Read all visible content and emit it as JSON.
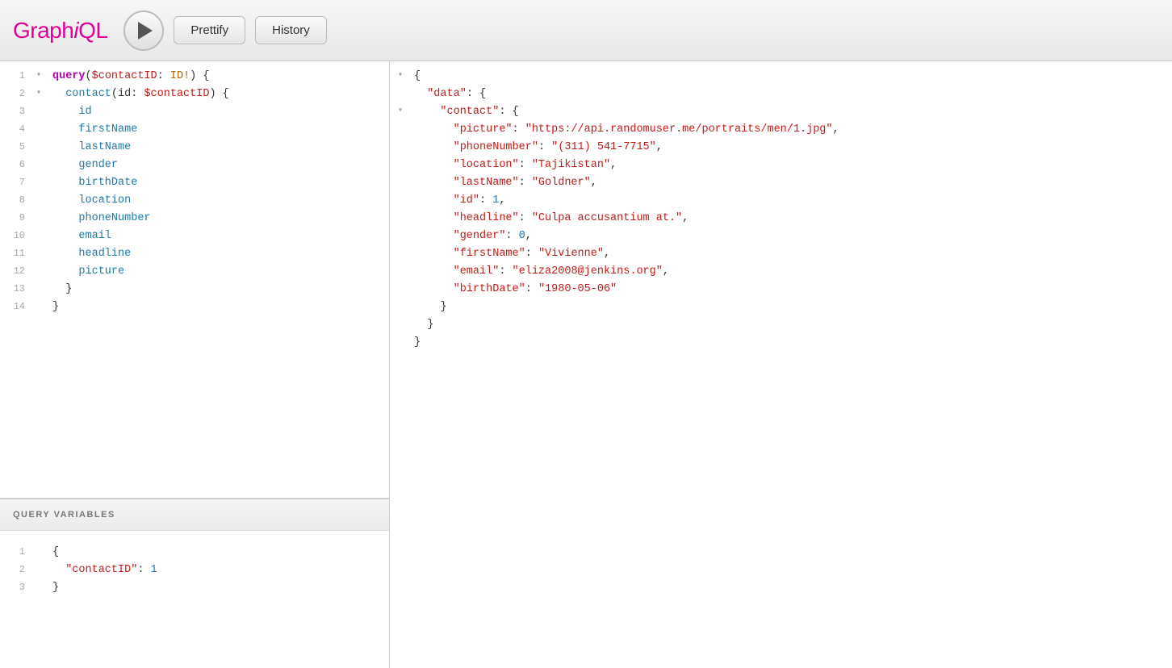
{
  "header": {
    "logo": "GraphiQL",
    "prettify_label": "Prettify",
    "history_label": "History"
  },
  "query_editor": {
    "lines": [
      {
        "num": "1",
        "arrow": "▾",
        "content": [
          {
            "t": "keyword",
            "v": "query"
          },
          {
            "t": "plain",
            "v": "("
          },
          {
            "t": "var",
            "v": "$contactID"
          },
          {
            "t": "plain",
            "v": ": "
          },
          {
            "t": "type",
            "v": "ID!"
          },
          {
            "t": "plain",
            "v": ") {"
          }
        ]
      },
      {
        "num": "2",
        "arrow": "▾",
        "content": [
          {
            "t": "plain",
            "v": "  "
          },
          {
            "t": "field",
            "v": "contact"
          },
          {
            "t": "plain",
            "v": "("
          },
          {
            "t": "plain",
            "v": "id"
          },
          {
            "t": "plain",
            "v": ": "
          },
          {
            "t": "var",
            "v": "$contactID"
          },
          {
            "t": "plain",
            "v": ") {"
          }
        ]
      },
      {
        "num": "3",
        "arrow": "",
        "content": [
          {
            "t": "plain",
            "v": "    "
          },
          {
            "t": "field",
            "v": "id"
          }
        ]
      },
      {
        "num": "4",
        "arrow": "",
        "content": [
          {
            "t": "plain",
            "v": "    "
          },
          {
            "t": "field",
            "v": "firstName"
          }
        ]
      },
      {
        "num": "5",
        "arrow": "",
        "content": [
          {
            "t": "plain",
            "v": "    "
          },
          {
            "t": "field",
            "v": "lastName"
          }
        ]
      },
      {
        "num": "6",
        "arrow": "",
        "content": [
          {
            "t": "plain",
            "v": "    "
          },
          {
            "t": "field",
            "v": "gender"
          }
        ]
      },
      {
        "num": "7",
        "arrow": "",
        "content": [
          {
            "t": "plain",
            "v": "    "
          },
          {
            "t": "field",
            "v": "birthDate"
          }
        ]
      },
      {
        "num": "8",
        "arrow": "",
        "content": [
          {
            "t": "plain",
            "v": "    "
          },
          {
            "t": "field",
            "v": "location"
          }
        ]
      },
      {
        "num": "9",
        "arrow": "",
        "content": [
          {
            "t": "plain",
            "v": "    "
          },
          {
            "t": "field",
            "v": "phoneNumber"
          }
        ]
      },
      {
        "num": "10",
        "arrow": "",
        "content": [
          {
            "t": "plain",
            "v": "    "
          },
          {
            "t": "field",
            "v": "email"
          }
        ]
      },
      {
        "num": "11",
        "arrow": "",
        "content": [
          {
            "t": "plain",
            "v": "    "
          },
          {
            "t": "field",
            "v": "headline"
          }
        ]
      },
      {
        "num": "12",
        "arrow": "",
        "content": [
          {
            "t": "plain",
            "v": "    "
          },
          {
            "t": "field",
            "v": "picture"
          }
        ]
      },
      {
        "num": "13",
        "arrow": "",
        "content": [
          {
            "t": "plain",
            "v": "  "
          },
          {
            "t": "plain",
            "v": "}"
          }
        ]
      },
      {
        "num": "14",
        "arrow": "",
        "content": [
          {
            "t": "plain",
            "v": "}"
          }
        ]
      }
    ]
  },
  "variables_header": "QUERY VARIABLES",
  "variables_lines": [
    {
      "num": "1",
      "content": [
        {
          "t": "plain",
          "v": "{"
        }
      ]
    },
    {
      "num": "2",
      "content": [
        {
          "t": "plain",
          "v": "  "
        },
        {
          "t": "key",
          "v": "\"contactID\""
        },
        {
          "t": "plain",
          "v": ": "
        },
        {
          "t": "num",
          "v": "1"
        }
      ]
    },
    {
      "num": "3",
      "content": [
        {
          "t": "plain",
          "v": "}"
        }
      ]
    }
  ],
  "result": {
    "lines": [
      {
        "arrow": "▾",
        "content": [
          {
            "t": "plain",
            "v": "{"
          }
        ]
      },
      {
        "arrow": "",
        "indent": "  ",
        "content": [
          {
            "t": "key",
            "v": "\"data\""
          },
          {
            "t": "plain",
            "v": ": {"
          }
        ]
      },
      {
        "arrow": "▾",
        "indent": "    ",
        "content": [
          {
            "t": "key",
            "v": "\"contact\""
          },
          {
            "t": "plain",
            "v": ": {"
          }
        ]
      },
      {
        "arrow": "",
        "indent": "      ",
        "content": [
          {
            "t": "key",
            "v": "\"picture\""
          },
          {
            "t": "plain",
            "v": ": "
          },
          {
            "t": "str",
            "v": "\"https://api.randomuser.me/portraits/men/1.jpg\""
          },
          {
            "t": "plain",
            "v": ","
          }
        ]
      },
      {
        "arrow": "",
        "indent": "      ",
        "content": [
          {
            "t": "key",
            "v": "\"phoneNumber\""
          },
          {
            "t": "plain",
            "v": ": "
          },
          {
            "t": "str",
            "v": "\"(311) 541-7715\""
          },
          {
            "t": "plain",
            "v": ","
          }
        ]
      },
      {
        "arrow": "",
        "indent": "      ",
        "content": [
          {
            "t": "key",
            "v": "\"location\""
          },
          {
            "t": "plain",
            "v": ": "
          },
          {
            "t": "str",
            "v": "\"Tajikistan\""
          },
          {
            "t": "plain",
            "v": ","
          }
        ]
      },
      {
        "arrow": "",
        "indent": "      ",
        "content": [
          {
            "t": "key",
            "v": "\"lastName\""
          },
          {
            "t": "plain",
            "v": ": "
          },
          {
            "t": "str",
            "v": "\"Goldner\""
          },
          {
            "t": "plain",
            "v": ","
          }
        ]
      },
      {
        "arrow": "",
        "indent": "      ",
        "content": [
          {
            "t": "key",
            "v": "\"id\""
          },
          {
            "t": "plain",
            "v": ": "
          },
          {
            "t": "num",
            "v": "1"
          },
          {
            "t": "plain",
            "v": ","
          }
        ]
      },
      {
        "arrow": "",
        "indent": "      ",
        "content": [
          {
            "t": "key",
            "v": "\"headline\""
          },
          {
            "t": "plain",
            "v": ": "
          },
          {
            "t": "str",
            "v": "\"Culpa accusantium at.\""
          },
          {
            "t": "plain",
            "v": ","
          }
        ]
      },
      {
        "arrow": "",
        "indent": "      ",
        "content": [
          {
            "t": "key",
            "v": "\"gender\""
          },
          {
            "t": "plain",
            "v": ": "
          },
          {
            "t": "num",
            "v": "0"
          },
          {
            "t": "plain",
            "v": ","
          }
        ]
      },
      {
        "arrow": "",
        "indent": "      ",
        "content": [
          {
            "t": "key",
            "v": "\"firstName\""
          },
          {
            "t": "plain",
            "v": ": "
          },
          {
            "t": "str",
            "v": "\"Vivienne\""
          },
          {
            "t": "plain",
            "v": ","
          }
        ]
      },
      {
        "arrow": "",
        "indent": "      ",
        "content": [
          {
            "t": "key",
            "v": "\"email\""
          },
          {
            "t": "plain",
            "v": ": "
          },
          {
            "t": "str",
            "v": "\"eliza2008@jenkins.org\""
          },
          {
            "t": "plain",
            "v": ","
          }
        ]
      },
      {
        "arrow": "",
        "indent": "      ",
        "content": [
          {
            "t": "key",
            "v": "\"birthDate\""
          },
          {
            "t": "plain",
            "v": ": "
          },
          {
            "t": "str",
            "v": "\"1980-05-06\""
          }
        ]
      },
      {
        "arrow": "",
        "indent": "    ",
        "content": [
          {
            "t": "plain",
            "v": "}"
          }
        ]
      },
      {
        "arrow": "",
        "indent": "  ",
        "content": [
          {
            "t": "plain",
            "v": "}"
          }
        ]
      },
      {
        "arrow": "",
        "indent": "",
        "content": [
          {
            "t": "plain",
            "v": "}"
          }
        ]
      }
    ]
  }
}
